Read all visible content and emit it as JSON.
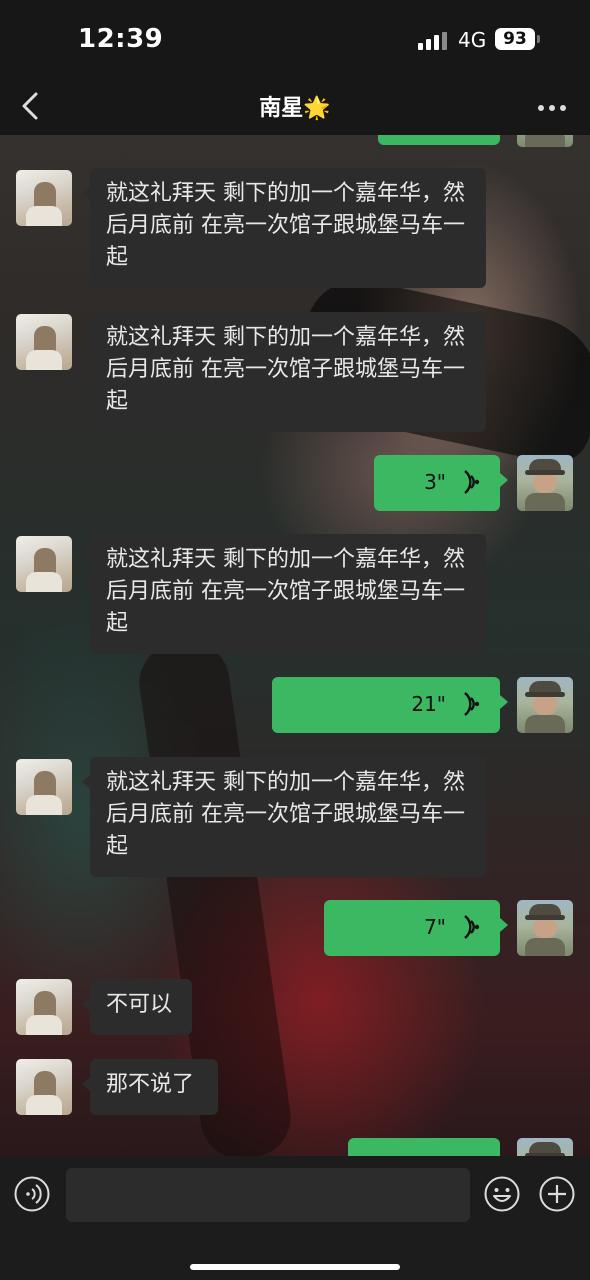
{
  "status_bar": {
    "time": "12:39",
    "network": "4G",
    "battery": "93"
  },
  "header": {
    "title": "南星🌟"
  },
  "messages": {
    "m1": {
      "sender": "contact",
      "text": "就这礼拜天 剩下的加一个嘉年华，然后月底前 在亮一次馆子跟城堡马车一起"
    },
    "m2": {
      "sender": "contact",
      "text": "就这礼拜天 剩下的加一个嘉年华，然后月底前 在亮一次馆子跟城堡马车一起"
    },
    "m3": {
      "sender": "me",
      "type": "voice",
      "duration": "3\""
    },
    "m4": {
      "sender": "contact",
      "text": "就这礼拜天 剩下的加一个嘉年华，然后月底前 在亮一次馆子跟城堡马车一起"
    },
    "m5": {
      "sender": "me",
      "type": "voice",
      "duration": "21\""
    },
    "m6": {
      "sender": "contact",
      "text": "就这礼拜天 剩下的加一个嘉年华，然后月底前 在亮一次馆子跟城堡马车一起"
    },
    "m7": {
      "sender": "me",
      "type": "voice",
      "duration": "7\""
    },
    "m8": {
      "sender": "contact",
      "text": "不可以"
    },
    "m9": {
      "sender": "contact",
      "text": "那不说了"
    }
  },
  "input_bar": {
    "placeholder": ""
  },
  "icons": {
    "back": "chevron-left-icon",
    "more": "more-dots-icon",
    "voice_wave": "voice-wave-icon",
    "voice_input": "voice-input-icon",
    "emoji": "emoji-icon",
    "plus": "plus-icon"
  },
  "colors": {
    "outgoing_bubble": "#3cb862",
    "incoming_bubble": "#2c2c2c",
    "bar": "#171717"
  }
}
